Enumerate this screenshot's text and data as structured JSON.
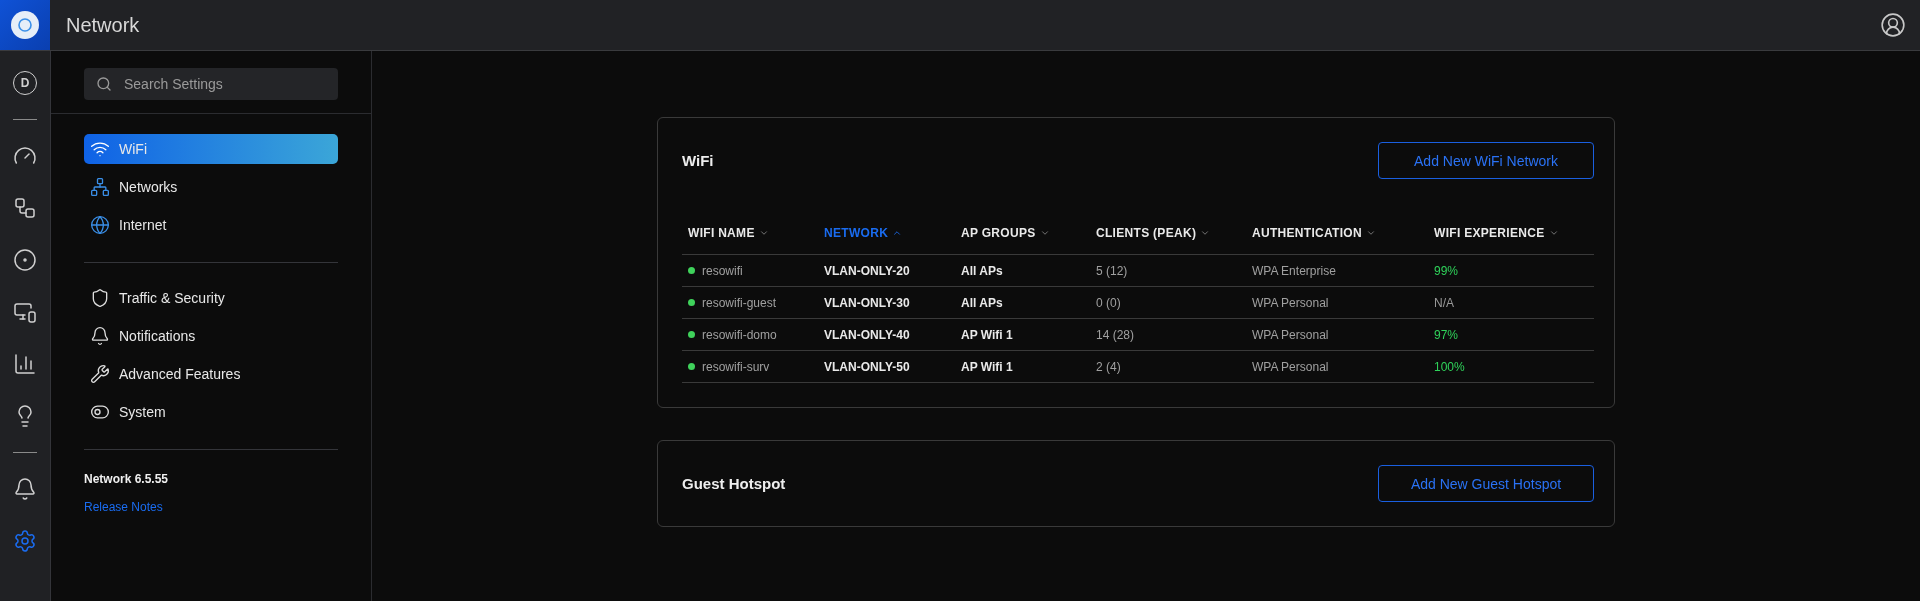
{
  "header": {
    "title": "Network"
  },
  "rail_groups": [
    [
      {
        "label": "D",
        "selected": false
      }
    ],
    [
      {
        "selected": false
      },
      {
        "selected": false
      },
      {
        "selected": false
      },
      {
        "selected": false
      },
      {
        "selected": false
      },
      {
        "selected": false
      }
    ],
    [
      {
        "selected": false
      },
      {
        "selected": true
      }
    ]
  ],
  "sidebar": {
    "search": {
      "placeholder": "Search Settings"
    },
    "groups": [
      [
        {
          "label": "WiFi",
          "selected": true
        },
        {
          "label": "Networks",
          "selected": false
        },
        {
          "label": "Internet",
          "selected": false
        }
      ],
      [
        {
          "label": "Traffic & Security",
          "selected": false
        },
        {
          "label": "Notifications",
          "selected": false
        },
        {
          "label": "Advanced Features",
          "selected": false
        },
        {
          "label": "System",
          "selected": false
        }
      ]
    ],
    "version": "Network 6.5.55",
    "release_notes": "Release Notes"
  },
  "wifi": {
    "title": "WiFi",
    "button": "Add New WiFi Network",
    "columns": [
      {
        "label": "WIFI NAME",
        "selected": false
      },
      {
        "label": "NETWORK",
        "selected": true
      },
      {
        "label": "AP GROUPS",
        "selected": false
      },
      {
        "label": "CLIENTS (PEAK)",
        "selected": false
      },
      {
        "label": "AUTHENTICATION",
        "selected": false
      },
      {
        "label": "WIFI EXPERIENCE",
        "selected": false
      }
    ],
    "rows": [
      {
        "name": "resowifi",
        "online": true,
        "network": "VLAN-ONLY-20",
        "ap_groups": "All APs",
        "clients": "5 (12)",
        "authentication": "WPA Enterprise",
        "experience": "99%",
        "good": true
      },
      {
        "name": "resowifi-guest",
        "online": true,
        "network": "VLAN-ONLY-30",
        "ap_groups": "All APs",
        "clients": "0 (0)",
        "authentication": "WPA Personal",
        "experience": "N/A",
        "good": false
      },
      {
        "name": "resowifi-domo",
        "online": true,
        "network": "VLAN-ONLY-40",
        "ap_groups": "AP Wifi 1",
        "clients": "14 (28)",
        "authentication": "WPA Personal",
        "experience": "97%",
        "good": true
      },
      {
        "name": "resowifi-surv",
        "online": true,
        "network": "VLAN-ONLY-50",
        "ap_groups": "AP Wifi 1",
        "clients": "2 (4)",
        "authentication": "WPA Personal",
        "experience": "100%",
        "good": true
      }
    ]
  },
  "guest_hotspot": {
    "title": "Guest Hotspot",
    "button": "Add New Guest Hotspot"
  }
}
